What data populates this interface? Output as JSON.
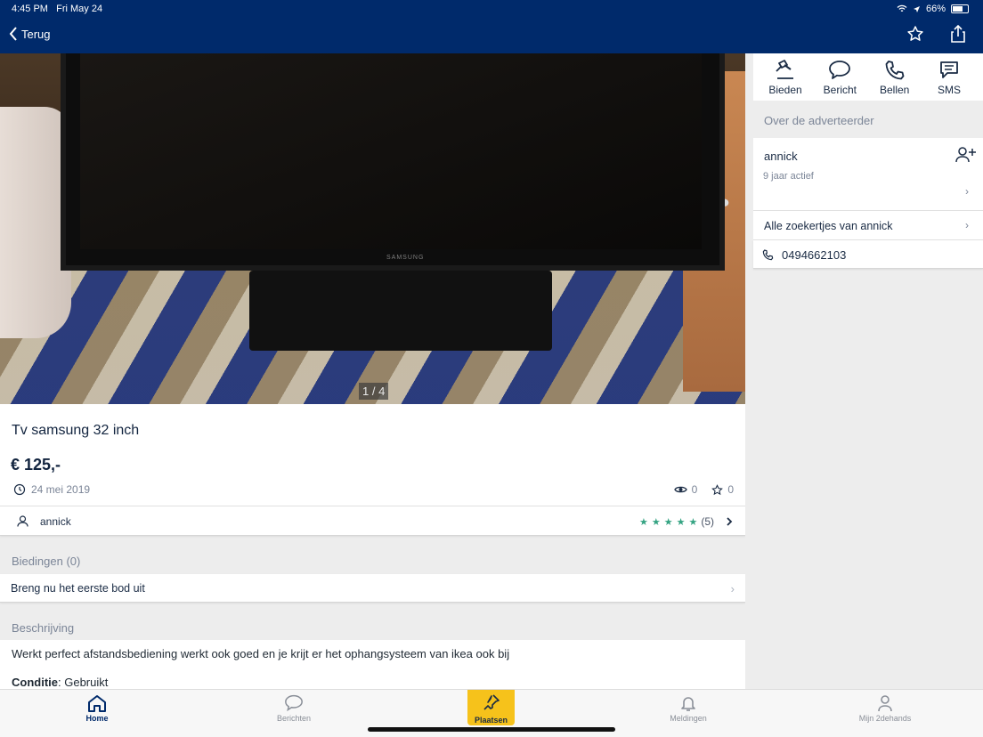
{
  "status_bar": {
    "time": "4:45 PM",
    "date": "Fri May 24",
    "battery": "66%",
    "battery_level": 0.66
  },
  "nav": {
    "back_label": "Terug"
  },
  "photo": {
    "counter": "1 / 4",
    "tv_brand": "SAMSUNG"
  },
  "listing": {
    "title": "Tv samsung 32 inch",
    "price": "€ 125,-",
    "date": "24 mei 2019",
    "views": "0",
    "favorites": "0",
    "seller": "annick",
    "rating_count": "(5)"
  },
  "bids": {
    "label": "Biedingen (0)",
    "cta": "Breng nu het eerste bod uit"
  },
  "description": {
    "label": "Beschrijving",
    "text": "Werkt perfect afstandsbediening werkt ook goed en je krijt er het ophangsysteem van ikea ook bij",
    "condition_key": "Conditie",
    "condition_value": ": Gebruikt"
  },
  "actions": [
    {
      "label": "Bieden",
      "icon": "gavel-icon"
    },
    {
      "label": "Bericht",
      "icon": "chat-bubble-icon"
    },
    {
      "label": "Bellen",
      "icon": "phone-icon"
    },
    {
      "label": "SMS",
      "icon": "sms-icon"
    }
  ],
  "advertiser": {
    "section_label": "Over de adverteerder",
    "name": "annick",
    "active": "9 jaar actief",
    "all_ads": "Alle zoekertjes van annick",
    "phone": "0494662103"
  },
  "tabs": [
    {
      "label": "Home",
      "icon": "home-icon",
      "active": true
    },
    {
      "label": "Berichten",
      "icon": "chat-icon",
      "active": false
    },
    {
      "label": "Plaatsen",
      "icon": "pin-icon",
      "active": false
    },
    {
      "label": "Meldingen",
      "icon": "bell-icon",
      "active": false
    },
    {
      "label": "Mijn 2dehands",
      "icon": "user-icon",
      "active": false
    }
  ],
  "colors": {
    "header": "#002a6b",
    "accent_yellow": "#f6c21b",
    "rating_green": "#34a382"
  }
}
